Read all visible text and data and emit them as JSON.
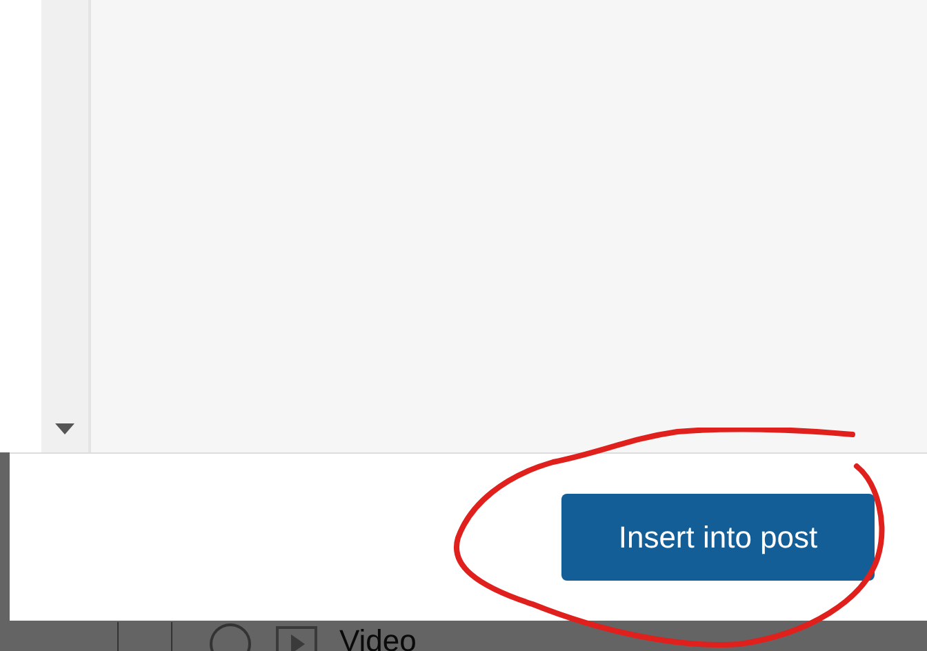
{
  "footer": {
    "button": "Insert into post"
  },
  "background_row": {
    "label": "Video"
  }
}
